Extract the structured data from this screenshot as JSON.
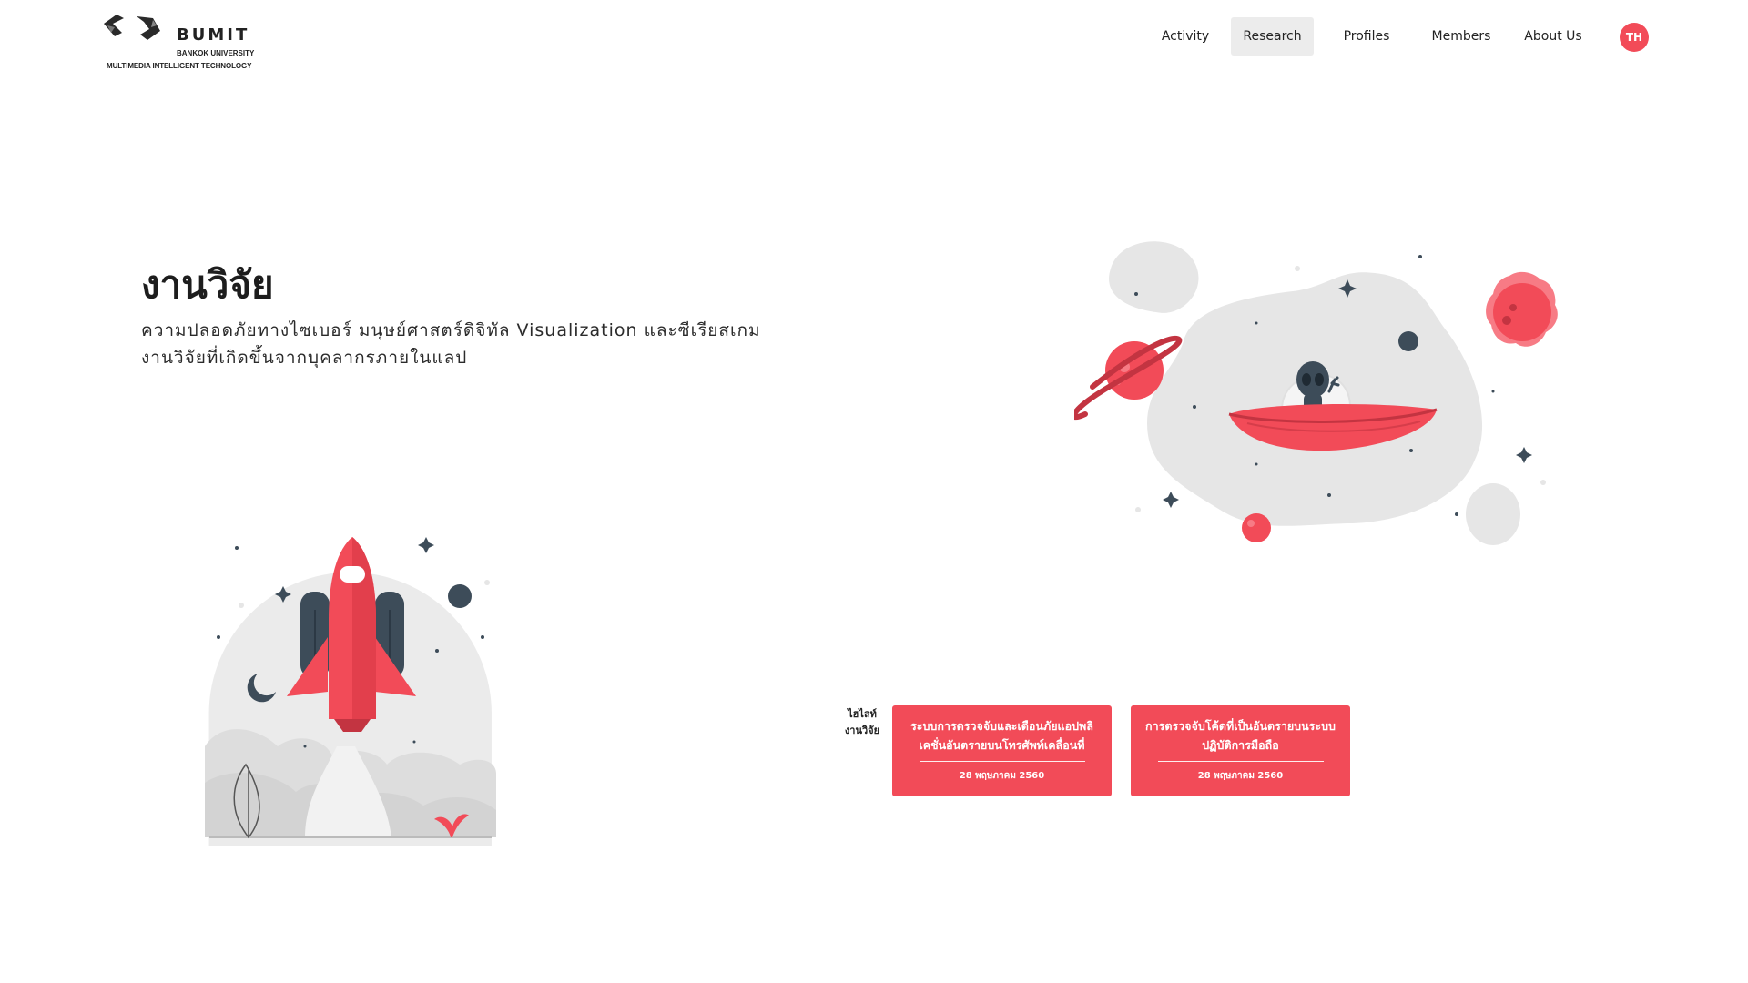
{
  "header": {
    "logo": {
      "name": "BUMIT",
      "subtitle_line1": "BANKOK UNIVERSITY",
      "subtitle_line2": "MULTIMEDIA INTELLIGENT TECHNOLOGY"
    },
    "nav": {
      "activity": "Activity",
      "research": "Research",
      "profiles": "Profiles",
      "members": "Members",
      "about": "About Us",
      "active": "Research"
    },
    "language": "TH"
  },
  "hero": {
    "title": "งานวิจัย",
    "subtitle_line1": "ความปลอดภัยทางไซเบอร์ มนุษย์ศาสตร์ดิจิทัล Visualization และซีเรียสเกม",
    "subtitle_line2": "งานวิจัยที่เกิดขึ้นจากบุคลากรภายในแลป"
  },
  "highlights": {
    "label_line1": "ไฮไลท์",
    "label_line2": "งานวิจัย",
    "items": [
      {
        "title": "ระบบการตรวจจับและเตือนภัยแอปพลิเคชั่นอันตรายบนโทรศัพท์เคลื่อนที่",
        "date": "28 พฤษภาคม 2560"
      },
      {
        "title": "การตรวจจับโค้ดที่เป็นอันตรายบนระบบปฏิบัติการมือถือ",
        "date": "28 พฤษภาคม 2560"
      }
    ]
  },
  "colors": {
    "accent": "#f24b58",
    "dark_accent": "#c33441",
    "slate": "#3d4c59",
    "cloud": "#e6e6e6"
  },
  "icons": {
    "logo": "bumit-logo-icon",
    "ufo_illustration": "alien-ufo-illustration-icon",
    "rocket_illustration": "rocket-launch-illustration-icon"
  }
}
